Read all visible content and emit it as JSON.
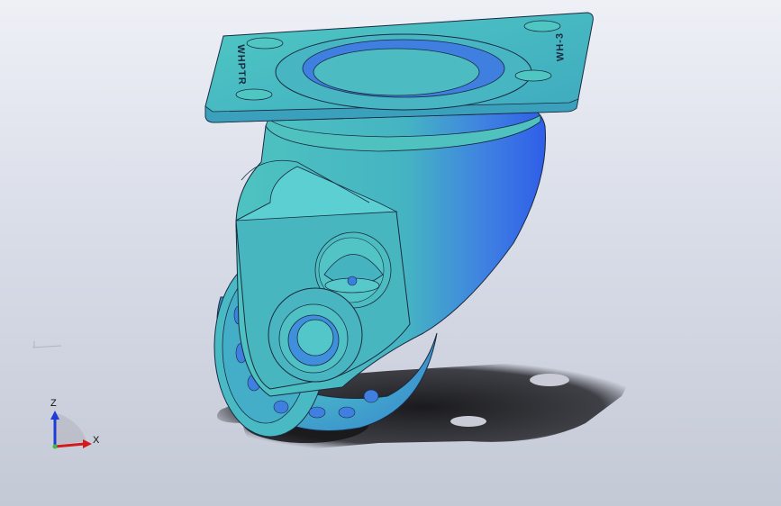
{
  "model": {
    "plate_engraving_left": "WHPTR",
    "plate_engraving_right": "WH-3"
  },
  "triad": {
    "z_label": "Z",
    "x_label": "X"
  },
  "colors": {
    "body_main": "#45b8bd",
    "body_shade": "#3a6ee8",
    "edge": "#1a2a40",
    "shadow": "#1c1c1f"
  }
}
